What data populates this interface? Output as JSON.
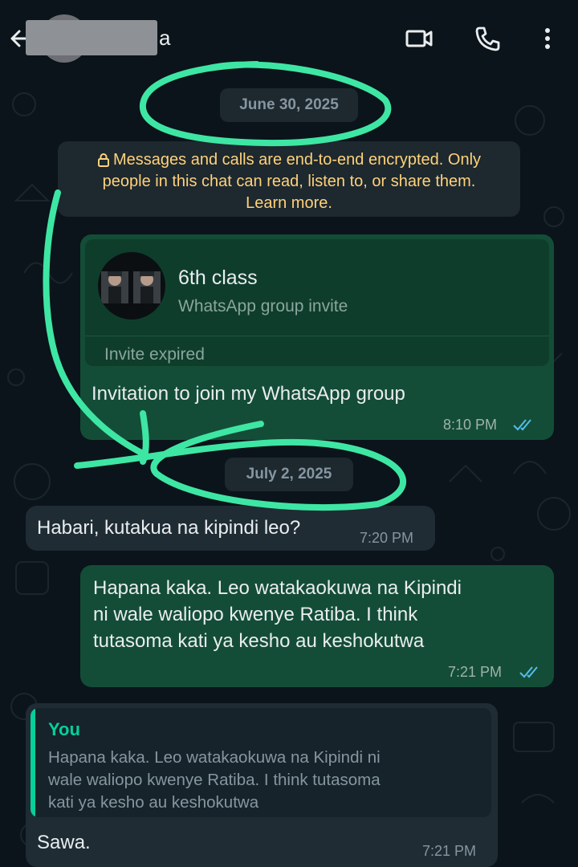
{
  "header": {
    "contact_name_visible": "a",
    "icons": [
      "back-arrow-icon",
      "video-call-icon",
      "voice-call-icon",
      "more-options-icon"
    ]
  },
  "chat": {
    "date_1": "June 30, 2025",
    "encryption_line_1": "Messages and calls are end-to-end encrypted. Only",
    "encryption_line_2": "people in this chat can read, listen to, or share them.",
    "encryption_line_3": "Learn more.",
    "invite": {
      "group_name": "6th class",
      "group_sub": "WhatsApp group invite",
      "status": "Invite expired",
      "text": "Invitation to join my WhatsApp group",
      "time": "8:10 PM"
    },
    "date_2": "July 2, 2025",
    "msg_in_1": {
      "text": "Habari, kutakua na kipindi leo?",
      "time": "7:20 PM"
    },
    "msg_out_2": {
      "line_1": "Hapana kaka. Leo watakaokuwa na Kipindi",
      "line_2": "ni wale waliopo kwenye Ratiba. I think",
      "line_3": "tutasoma kati ya kesho au keshokutwa",
      "time": "7:21 PM"
    },
    "msg_in_3": {
      "quote_author": "You",
      "quote_line_1": "Hapana kaka. Leo watakaokuwa na Kipindi ni",
      "quote_line_2": "wale waliopo kwenye Ratiba. I think tutasoma",
      "quote_line_3": "kati ya kesho au keshokutwa",
      "text": "Sawa.",
      "time": "7:21 PM"
    }
  },
  "colors": {
    "background": "#0b141a",
    "outgoing_bubble": "#144d37",
    "incoming_bubble": "#1f2c34",
    "read_ticks": "#53bdeb",
    "encryption_text": "#ffd279",
    "highlighter": "#3ee6a4"
  }
}
